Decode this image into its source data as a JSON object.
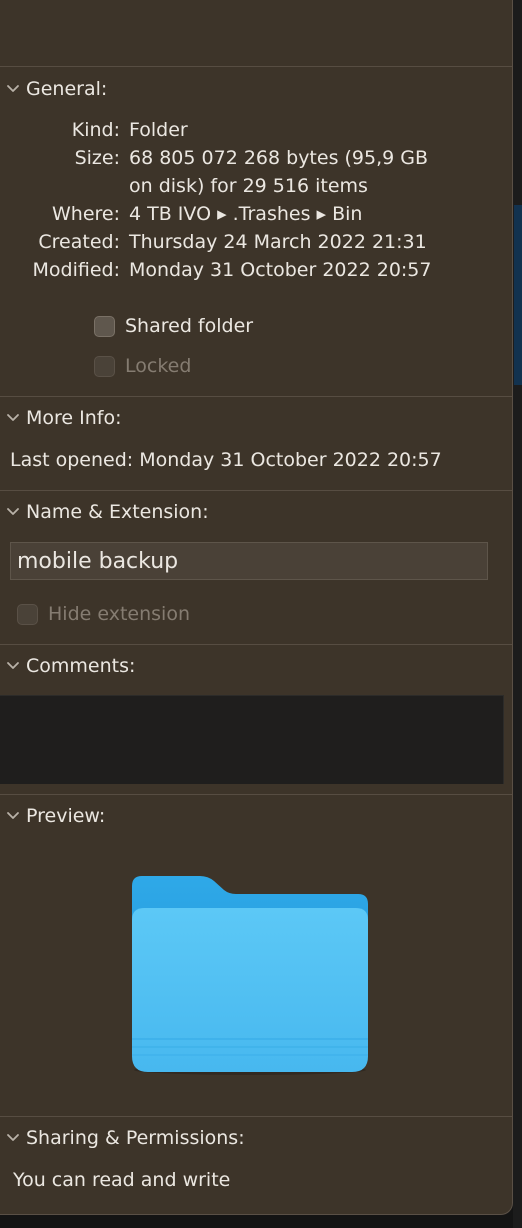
{
  "general": {
    "header": "General:",
    "rows": [
      {
        "label": "Kind:",
        "value": "Folder"
      },
      {
        "label": "Size:",
        "value": "68 805 072 268 bytes (95,9 GB",
        "value2": "on disk) for 29 516 items"
      },
      {
        "label": "Where:",
        "value": "4 TB IVO ▸ .Trashes ▸ Bin"
      },
      {
        "label": "Created:",
        "value": "Thursday 24 March 2022 21:31"
      },
      {
        "label": "Modified:",
        "value": "Monday 31 October 2022 20:57"
      }
    ],
    "shared_folder_label": "Shared folder",
    "locked_label": "Locked"
  },
  "more_info": {
    "header": "More Info:",
    "last_opened_label": "Last opened:",
    "last_opened_value": "Monday 31 October 2022 20:57"
  },
  "name_extension": {
    "header": "Name & Extension:",
    "name_value": "mobile backup",
    "hide_extension_label": "Hide extension"
  },
  "comments": {
    "header": "Comments:"
  },
  "preview": {
    "header": "Preview:",
    "icon": "folder-icon"
  },
  "sharing": {
    "header": "Sharing & Permissions:",
    "status": "You can read and write"
  },
  "colors": {
    "panel_bg": "#3d3429",
    "folder_blue": "#4cc0f3",
    "comments_bg": "#1f1e1d"
  }
}
